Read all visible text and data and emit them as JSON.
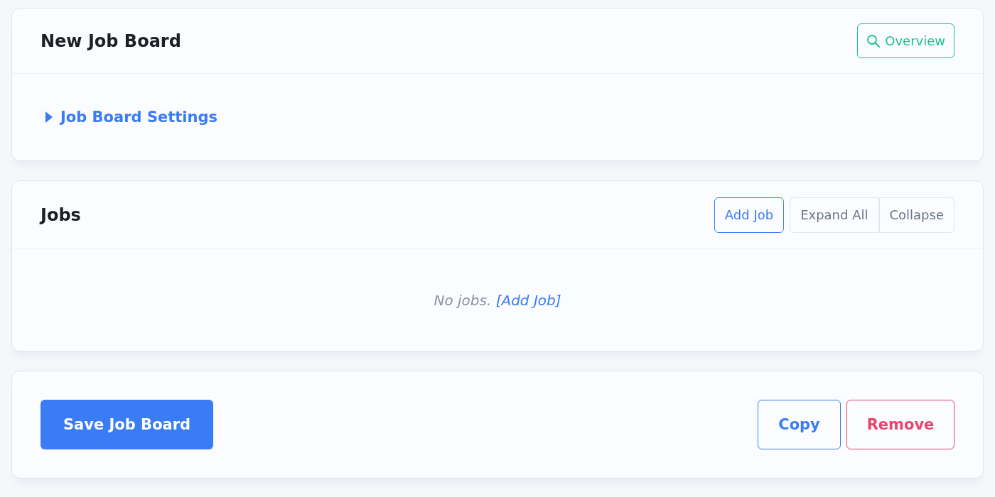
{
  "board": {
    "title": "New Job Board",
    "overview_button": "Overview",
    "settings": {
      "label": "Job Board Settings",
      "expanded": false
    }
  },
  "jobs": {
    "title": "Jobs",
    "buttons": [
      {
        "label": "Add Job",
        "kind": "primary"
      },
      {
        "label": "Expand All",
        "kind": "secondary"
      },
      {
        "label": "Collapse",
        "kind": "secondary"
      }
    ],
    "empty_text": "No jobs.",
    "empty_link": "[Add Job]"
  },
  "footer": {
    "save_button": "Save Job Board",
    "copy_button": "Copy",
    "remove_button": "Remove"
  }
}
